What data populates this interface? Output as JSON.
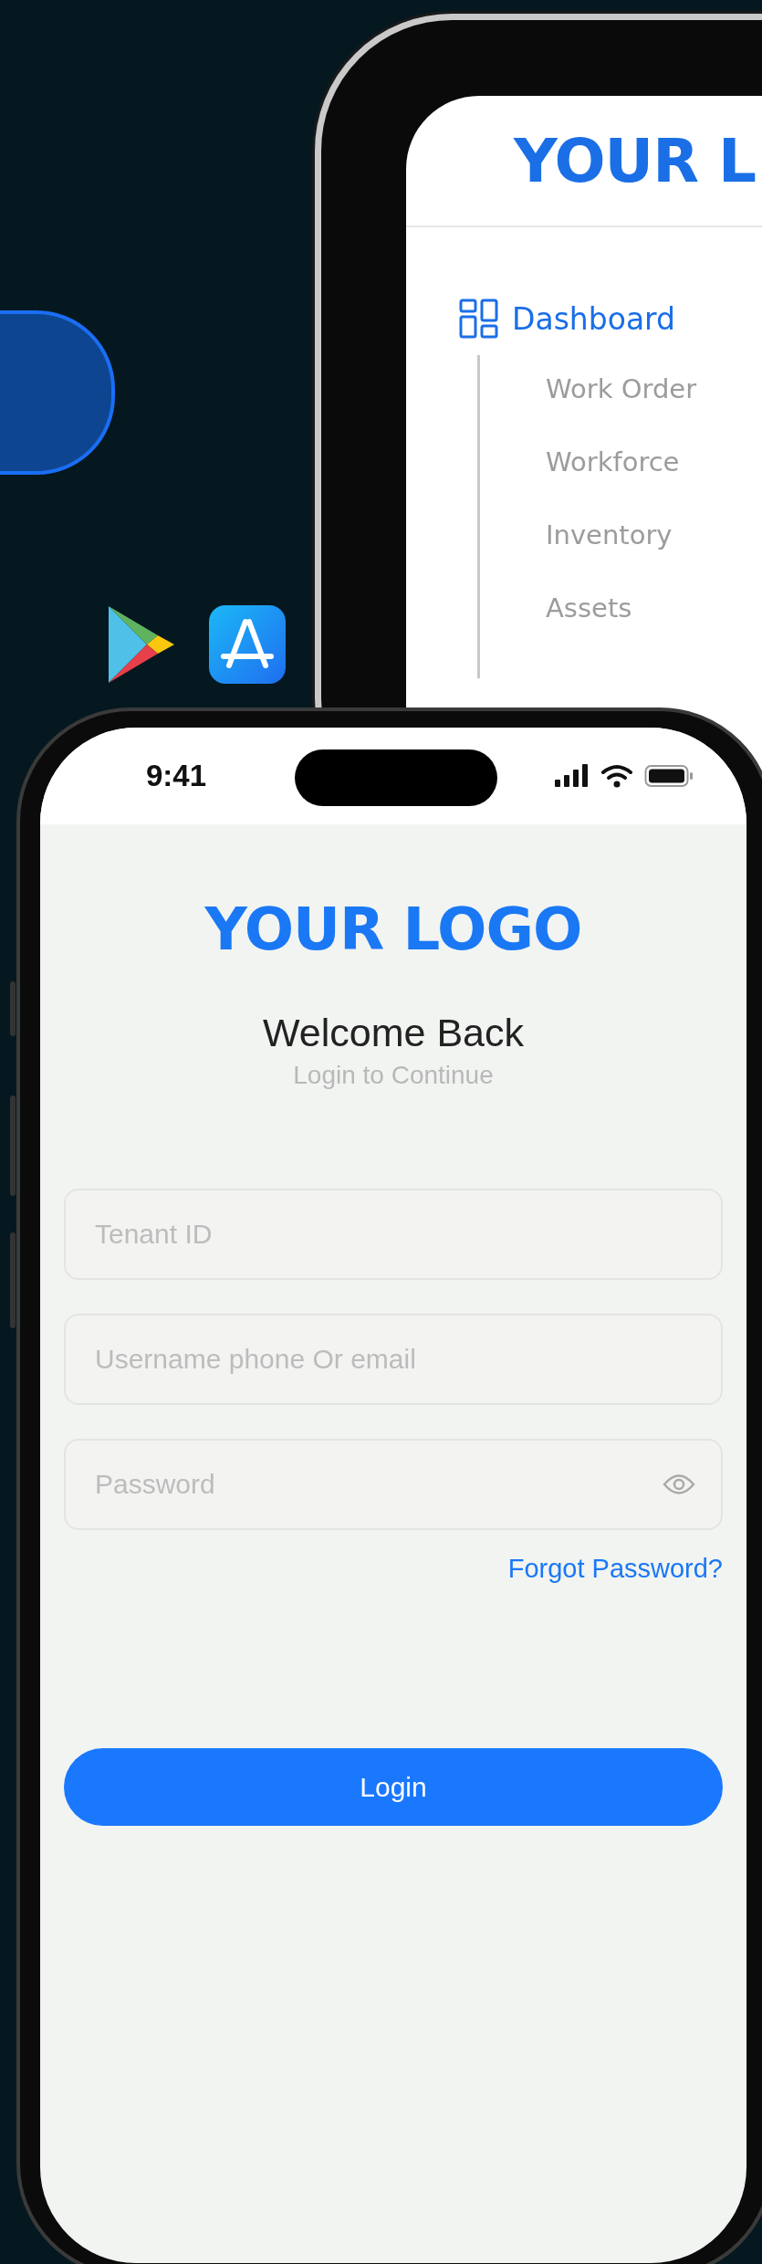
{
  "back_screen": {
    "logo": "YOUR L",
    "nav": [
      {
        "label": "Dashboard",
        "selected": true,
        "children": [
          {
            "label": "Work Order",
            "selected": false
          },
          {
            "label": "Workforce",
            "selected": false
          },
          {
            "label": "Inventory",
            "selected": false
          },
          {
            "label": "Assets",
            "selected": false
          }
        ]
      }
    ]
  },
  "front_screen": {
    "status_bar": {
      "time": "9:41"
    },
    "logo": "YOUR LOGO",
    "title": "Welcome Back",
    "subtitle": "Login to Continue",
    "fields": [
      {
        "placeholder": "Tenant ID",
        "kind": "text"
      },
      {
        "placeholder": "Username phone Or email",
        "kind": "text"
      },
      {
        "placeholder": "Password",
        "kind": "password"
      }
    ],
    "forgot_link": "Forgot Password?",
    "login_button": "Login"
  }
}
